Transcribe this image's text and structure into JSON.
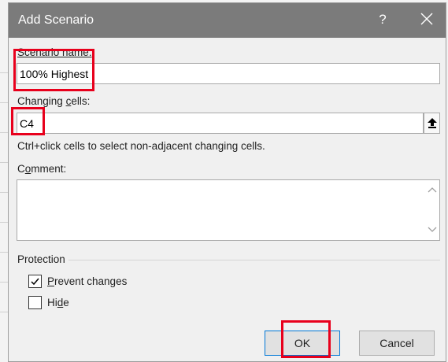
{
  "dialog": {
    "title": "Add Scenario",
    "help_glyph": "?",
    "scenario_name": {
      "label_pre": "S",
      "label_rest": "cenario name:",
      "value": "100% Highest"
    },
    "changing_cells": {
      "label_pre": "Changing ",
      "label_accel": "c",
      "label_post": "ells:",
      "value": "C4",
      "hint": "Ctrl+click cells to select non-adjacent changing cells."
    },
    "comment": {
      "label_pre": "C",
      "label_accel": "o",
      "label_post": "mment:",
      "value": ""
    },
    "protection": {
      "group_label": "Protection",
      "prevent_changes": {
        "accel": "P",
        "rest": "revent changes",
        "checked": true
      },
      "hide": {
        "pre": "Hi",
        "accel": "d",
        "post": "e",
        "checked": false
      }
    },
    "buttons": {
      "ok": "OK",
      "cancel": "Cancel"
    }
  },
  "annotations": {
    "highlight_color": "#e8001c"
  },
  "colors": {
    "titlebar": "#7b7b7b",
    "dialog_bg": "#f0f0f0",
    "default_button_border": "#0078d7"
  }
}
